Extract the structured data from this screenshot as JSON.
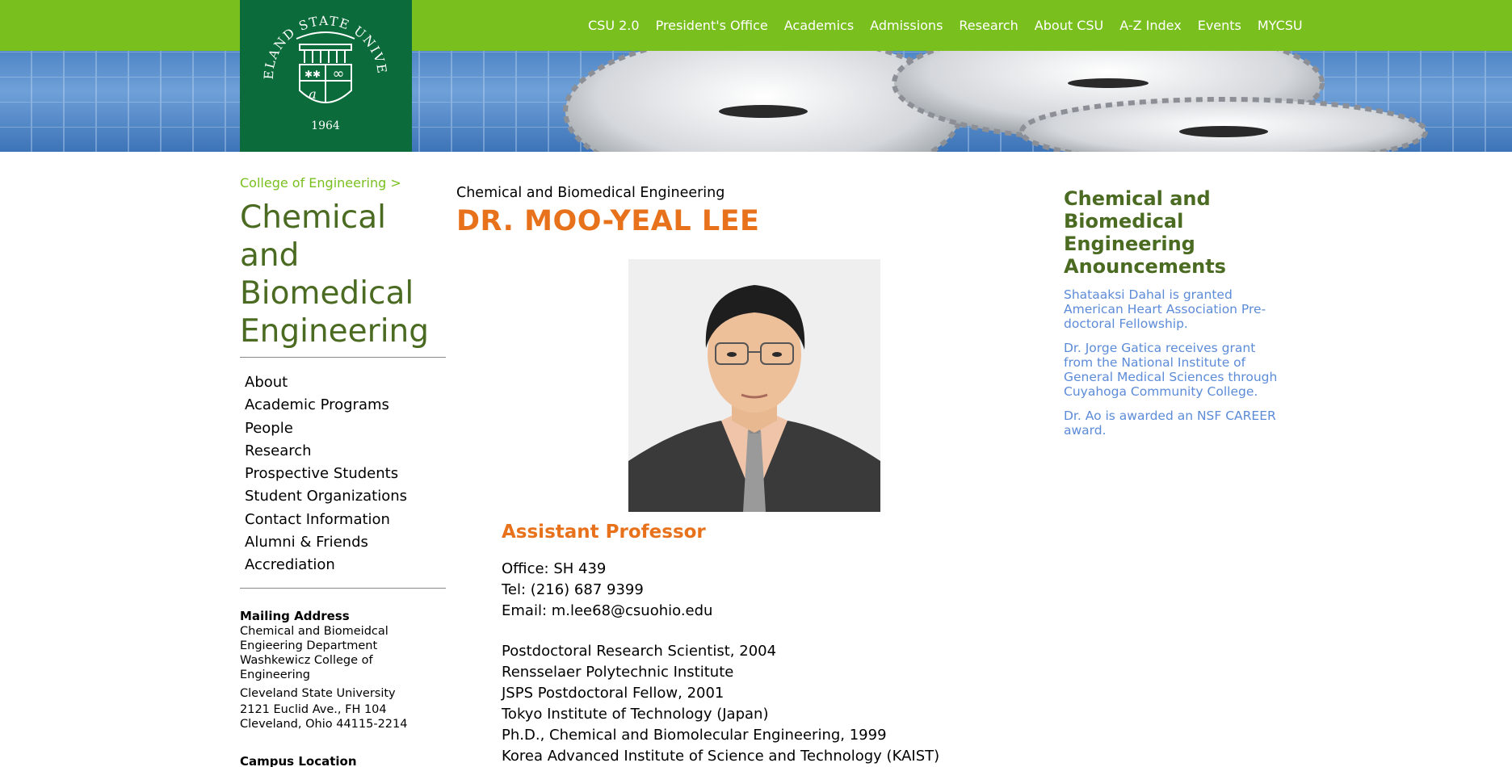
{
  "header": {
    "logo": {
      "name": "CLEVELAND STATE UNIVERSITY",
      "year": "1964"
    },
    "nav": [
      "CSU 2.0",
      "President's Office",
      "Academics",
      "Admissions",
      "Research",
      "About CSU",
      "A-Z Index",
      "Events",
      "MYCSU"
    ]
  },
  "sidebar": {
    "breadcrumb": "College of Engineering >",
    "dept_title": "Chemical and Biomedical Engineering",
    "nav": [
      "About",
      "Academic Programs",
      "People",
      "Research",
      "Prospective Students",
      "Student Organizations",
      "Contact Information",
      "Alumni & Friends",
      "Accrediation"
    ],
    "mailing_heading": "Mailing Address",
    "mailing_lines": [
      "Chemical and Biomeidcal Engieering Department Washkewicz College of Engineering"
    ],
    "university": "Cleveland State University",
    "street": "2121 Euclid Ave., FH 104",
    "city": "Cleveland, Ohio 44115-2214",
    "campus_heading": "Campus Location"
  },
  "main": {
    "subtitle": "Chemical and Biomedical Engineering",
    "name": "DR. MOO-YEAL LEE",
    "position": "Assistant Professor",
    "contact": {
      "office": "Office: SH 439",
      "tel": "Tel: (216) 687 9399",
      "email": "Email: m.lee68@csuohio.edu"
    },
    "education": [
      "Postdoctoral Research Scientist, 2004",
      "Rensselaer Polytechnic Institute",
      "JSPS Postdoctoral Fellow, 2001",
      "Tokyo Institute of Technology (Japan)",
      "Ph.D., Chemical and Biomolecular Engineering, 1999",
      "Korea Advanced Institute of Science and Technology (KAIST)"
    ]
  },
  "announcements": {
    "title": "Chemical and Biomedical Engineering Anouncements",
    "items": [
      "Shataaksi Dahal is granted American Heart Association Pre-doctoral Fellowship.",
      "Dr. Jorge Gatica receives grant from the National Institute of General Medical Sciences through Cuyahoga Community College.",
      "Dr. Ao is awarded an NSF CAREER award."
    ]
  },
  "colors": {
    "brand_green": "#79c01f",
    "logo_green": "#0b6b3a",
    "heading_green": "#4a6b21",
    "accent_orange": "#e8721c",
    "link_blue": "#5c8bd8"
  }
}
